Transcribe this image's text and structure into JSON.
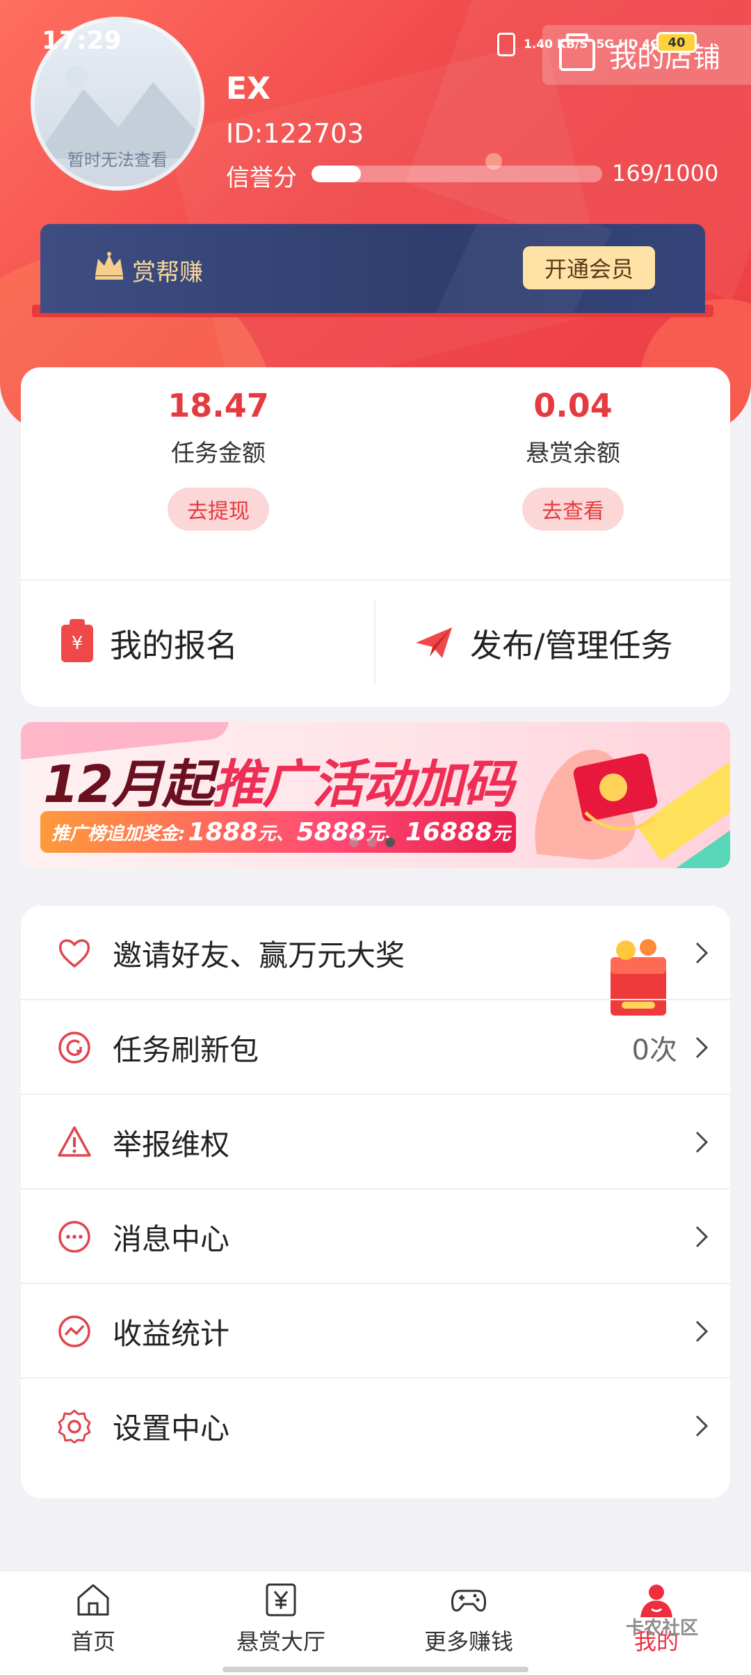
{
  "status_bar": {
    "time": "17:29",
    "network_speed": "1.40 KB/S",
    "signal": "5G HD 4G+ HD",
    "battery": "40"
  },
  "header": {
    "shop_button": "我的店铺",
    "avatar_text": "暂时无法查看",
    "username": "EX",
    "user_id": "ID:122703",
    "credit_label": "信誉分",
    "credit_value": "169/1000",
    "credit_fraction": 0.169
  },
  "vip": {
    "title": "赏帮赚",
    "button": "开通会员"
  },
  "wallet": {
    "task_amount": "18.47",
    "task_label": "任务金额",
    "task_button": "去提现",
    "reward_amount": "0.04",
    "reward_label": "悬赏余额",
    "reward_button": "去查看"
  },
  "actions": {
    "my_signup": "我的报名",
    "publish_manage": "发布/管理任务"
  },
  "banner": {
    "title_dark": "12月起",
    "title_red": "推广活动加码",
    "sub_prefix": "推广榜追加奖金:",
    "amounts": [
      "1888",
      "5888",
      "16888"
    ],
    "unit": "元",
    "slide_count": 3,
    "active_slide": 2
  },
  "menu": [
    {
      "label": "邀请好友、赢万元大奖",
      "value": "",
      "icon": "heart-icon"
    },
    {
      "label": "任务刷新包",
      "value": "0次",
      "icon": "refresh-icon"
    },
    {
      "label": "举报维权",
      "value": "",
      "icon": "warning-icon"
    },
    {
      "label": "消息中心",
      "value": "",
      "icon": "message-icon"
    },
    {
      "label": "收益统计",
      "value": "",
      "icon": "chart-icon"
    },
    {
      "label": "设置中心",
      "value": "",
      "icon": "gear-icon"
    }
  ],
  "bottom_nav": [
    {
      "label": "首页",
      "icon": "home-icon"
    },
    {
      "label": "悬赏大厅",
      "icon": "yen-icon"
    },
    {
      "label": "更多赚钱",
      "icon": "gamepad-icon"
    },
    {
      "label": "我的",
      "icon": "profile-icon"
    }
  ],
  "watermark": "卡农社区",
  "colors": {
    "brand_red": "#ee3f45",
    "vip_navy": "#34447a",
    "vip_gold": "#ffe2a6",
    "amount_red": "#e53a3f"
  }
}
